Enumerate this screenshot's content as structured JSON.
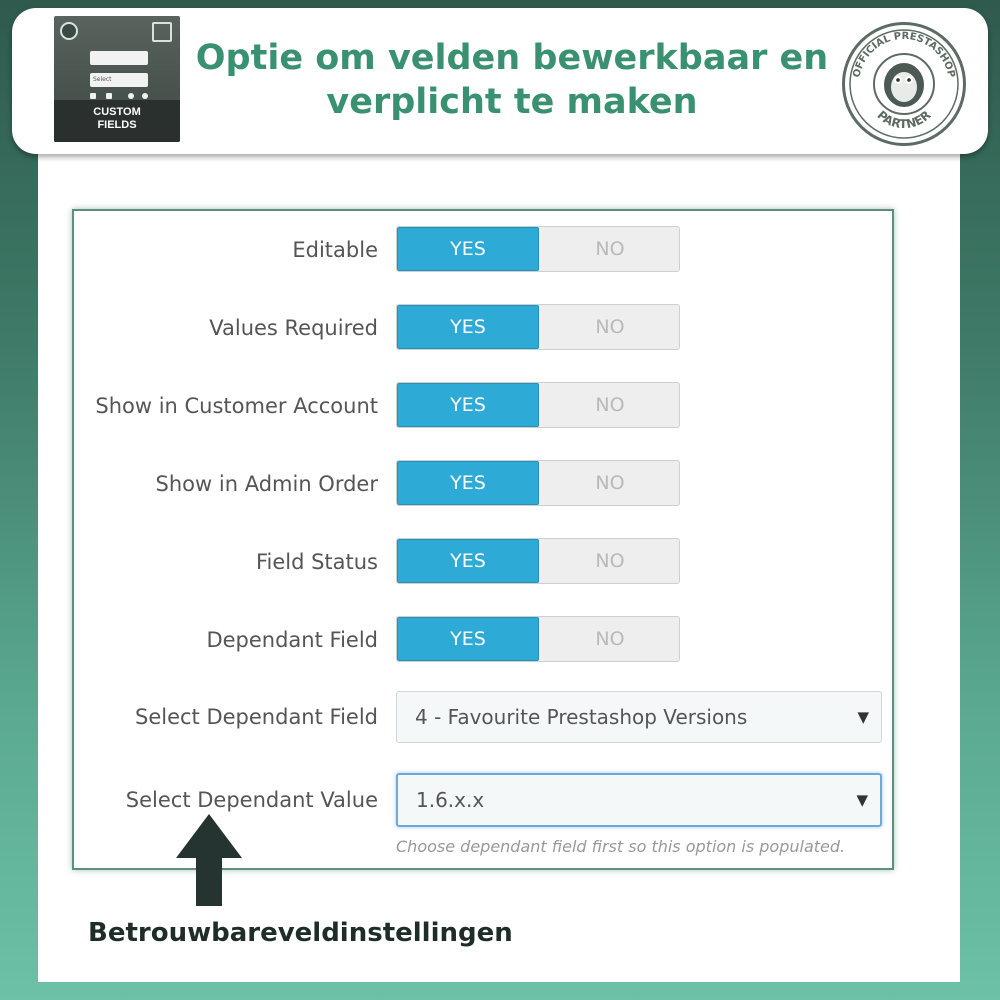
{
  "header": {
    "headline_line1": "Optie om velden bewerkbaar en",
    "headline_line2": "verplicht te maken",
    "logo_text_line1": "CUSTOM",
    "logo_text_line2": "FIELDS",
    "logo_select_text": "Select",
    "badge_text_top": "OFFICIAL PRESTASHOP",
    "badge_text_bottom": "PARTNER"
  },
  "form": {
    "toggles": [
      {
        "label": "Editable",
        "yes": "YES",
        "no": "NO",
        "value": "YES"
      },
      {
        "label": "Values Required",
        "yes": "YES",
        "no": "NO",
        "value": "YES"
      },
      {
        "label": "Show in Customer Account",
        "yes": "YES",
        "no": "NO",
        "value": "YES"
      },
      {
        "label": "Show in Admin Order",
        "yes": "YES",
        "no": "NO",
        "value": "YES"
      },
      {
        "label": "Field Status",
        "yes": "YES",
        "no": "NO",
        "value": "YES"
      },
      {
        "label": "Dependant Field",
        "yes": "YES",
        "no": "NO",
        "value": "YES"
      }
    ],
    "select_field": {
      "label": "Select Dependant Field",
      "value": "4 - Favourite Prestashop Versions"
    },
    "select_value": {
      "label": "Select Dependant Value",
      "value": "1.6.x.x"
    },
    "help_text": "Choose dependant field first so this option is populated."
  },
  "caption": "Betrouwbareveldinstellingen",
  "colors": {
    "accent_green": "#3a9172",
    "toggle_active": "#2eaad6",
    "arrow": "#253430"
  },
  "icons": [
    "select-caret-icon",
    "up-arrow-icon",
    "prestashop-partner-badge-icon"
  ]
}
